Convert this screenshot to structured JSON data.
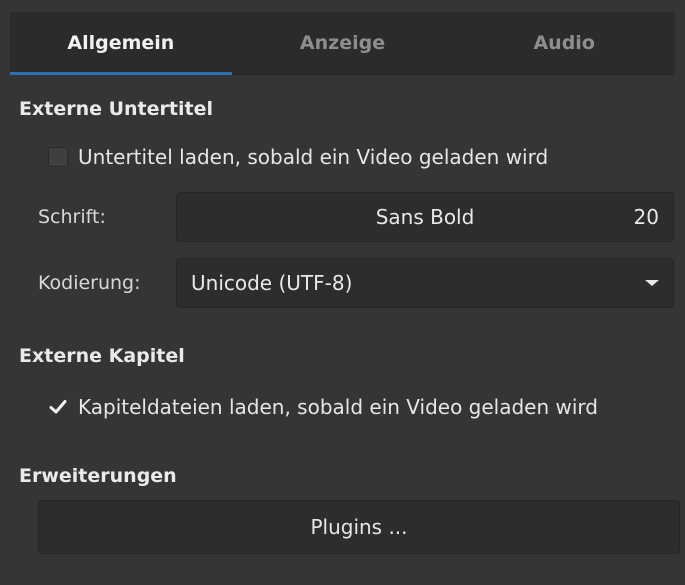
{
  "tabs": [
    {
      "label": "Allgemein",
      "active": true
    },
    {
      "label": "Anzeige",
      "active": false
    },
    {
      "label": "Audio",
      "active": false
    }
  ],
  "subtitles": {
    "heading": "Externe Untertitel",
    "autoload_label": "Untertitel laden, sobald ein Video geladen wird",
    "autoload_checked": false,
    "font_label": "Schrift:",
    "font_name": "Sans Bold",
    "font_size": "20",
    "encoding_label": "Kodierung:",
    "encoding_value": "Unicode (UTF-8)"
  },
  "chapters": {
    "heading": "Externe Kapitel",
    "autoload_label": "Kapiteldateien laden, sobald ein Video geladen wird",
    "autoload_checked": true
  },
  "extensions": {
    "heading": "Erweiterungen",
    "plugins_label": "Plugins ..."
  },
  "colors": {
    "accent": "#2f6fb3",
    "background": "#353535",
    "control_bg": "#2d2d2d"
  }
}
